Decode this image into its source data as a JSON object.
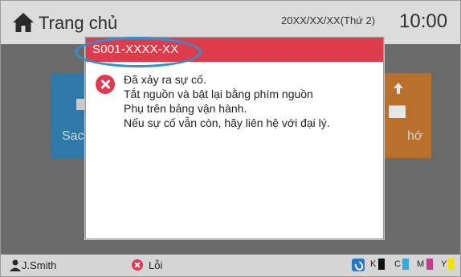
{
  "header": {
    "title": "Trang chủ",
    "date": "20XX/XX/XX(Thứ 2)",
    "time": "10:00"
  },
  "tiles": {
    "left_label_partial": "Sac",
    "right_label_partial": "hớ"
  },
  "dialog": {
    "code": "S001-XXXX-XX",
    "lines": [
      "Đã xảy ra sự cố.",
      "Tắt nguồn và bật lại bằng phím nguồn",
      "Phụ trên bảng vận hành.",
      "Nếu sự cố vẫn còn, hãy liên hệ với đại lý."
    ]
  },
  "statusbar": {
    "user": "J.Smith",
    "error_label": "Lỗi",
    "inks": [
      "K",
      "C",
      "M",
      "Y"
    ],
    "ink_colors": [
      "#111111",
      "#35a8dc",
      "#c73a93",
      "#f2e200"
    ]
  }
}
